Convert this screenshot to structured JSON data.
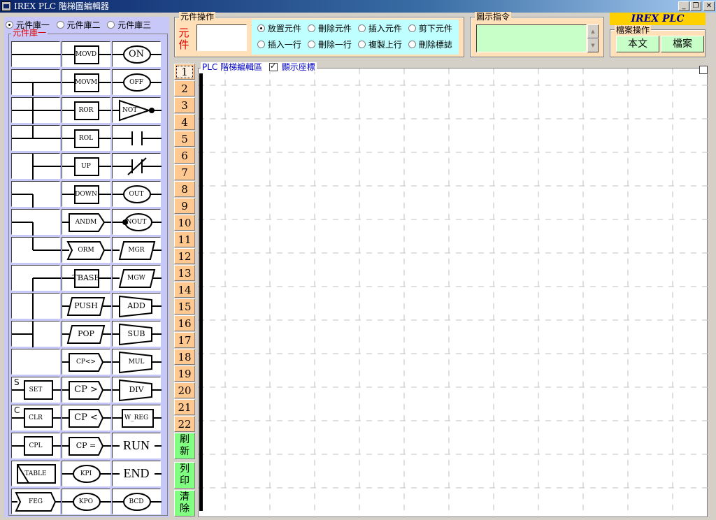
{
  "window": {
    "title": "IREX PLC 階梯圖編輯器",
    "minimize": "_",
    "restore": "❐",
    "close": "✕"
  },
  "library": {
    "tabs": [
      {
        "label": "元件庫一",
        "selected": true
      },
      {
        "label": "元件庫二",
        "selected": false
      },
      {
        "label": "元件庫三",
        "selected": false
      }
    ],
    "group_label": "元件庫一",
    "col2": [
      "MOVD",
      "MOVM",
      "ROR",
      "ROL",
      "UP",
      "DOWN",
      "ANDM",
      "ORM",
      "TBASE",
      "PUSH",
      "POP",
      "CP<>",
      "CP >",
      "CP <",
      "CP =",
      "KPI",
      "KPO"
    ],
    "col3": [
      "ON",
      "OFF",
      "NOT",
      "",
      "",
      "OUT",
      "NOUT",
      "MGR",
      "MGW",
      "ADD",
      "SUB",
      "MUL",
      "DIV",
      "W_REG",
      "RUN",
      "END",
      "BCD"
    ],
    "col1": {
      "set": "SET",
      "set_corner": "S",
      "clr": "CLR",
      "clr_corner": "C",
      "cpl": "CPL",
      "table": "TABLE",
      "feg": "FEG"
    }
  },
  "element_ops": {
    "title": "元件操作",
    "element_label": "元件",
    "options": [
      {
        "label": "放置元件",
        "selected": true
      },
      {
        "label": "刪除元件",
        "selected": false
      },
      {
        "label": "插入元件",
        "selected": false
      },
      {
        "label": "剪下元件",
        "selected": false
      },
      {
        "label": "插入一行",
        "selected": false
      },
      {
        "label": "刪除一行",
        "selected": false
      },
      {
        "label": "複製上行",
        "selected": false
      },
      {
        "label": "刪除標誌",
        "selected": false
      }
    ]
  },
  "command_display": {
    "title": "圖示指令"
  },
  "brand": "IREX PLC",
  "file_ops": {
    "title": "檔案操作",
    "text_button": "本文",
    "file_button": "檔案"
  },
  "rows": [
    "1",
    "2",
    "3",
    "4",
    "5",
    "6",
    "7",
    "8",
    "9",
    "10",
    "11",
    "12",
    "13",
    "14",
    "15",
    "16",
    "17",
    "18",
    "19",
    "20",
    "21",
    "22"
  ],
  "actions": {
    "refresh": "刷新",
    "print": "列印",
    "clear": "清除"
  },
  "editor": {
    "title": "PLC 階梯編輯區",
    "show_coords_label": "顯示座標",
    "show_coords": true
  },
  "colors": {
    "library_bg": "#c8c8f8",
    "ops_bg": "#ffe0b8",
    "radio_bg": "#c0ffff",
    "green_buttons": "#80ff80",
    "row_numbers": "#ffc890",
    "brand_bg": "#ffd000"
  }
}
